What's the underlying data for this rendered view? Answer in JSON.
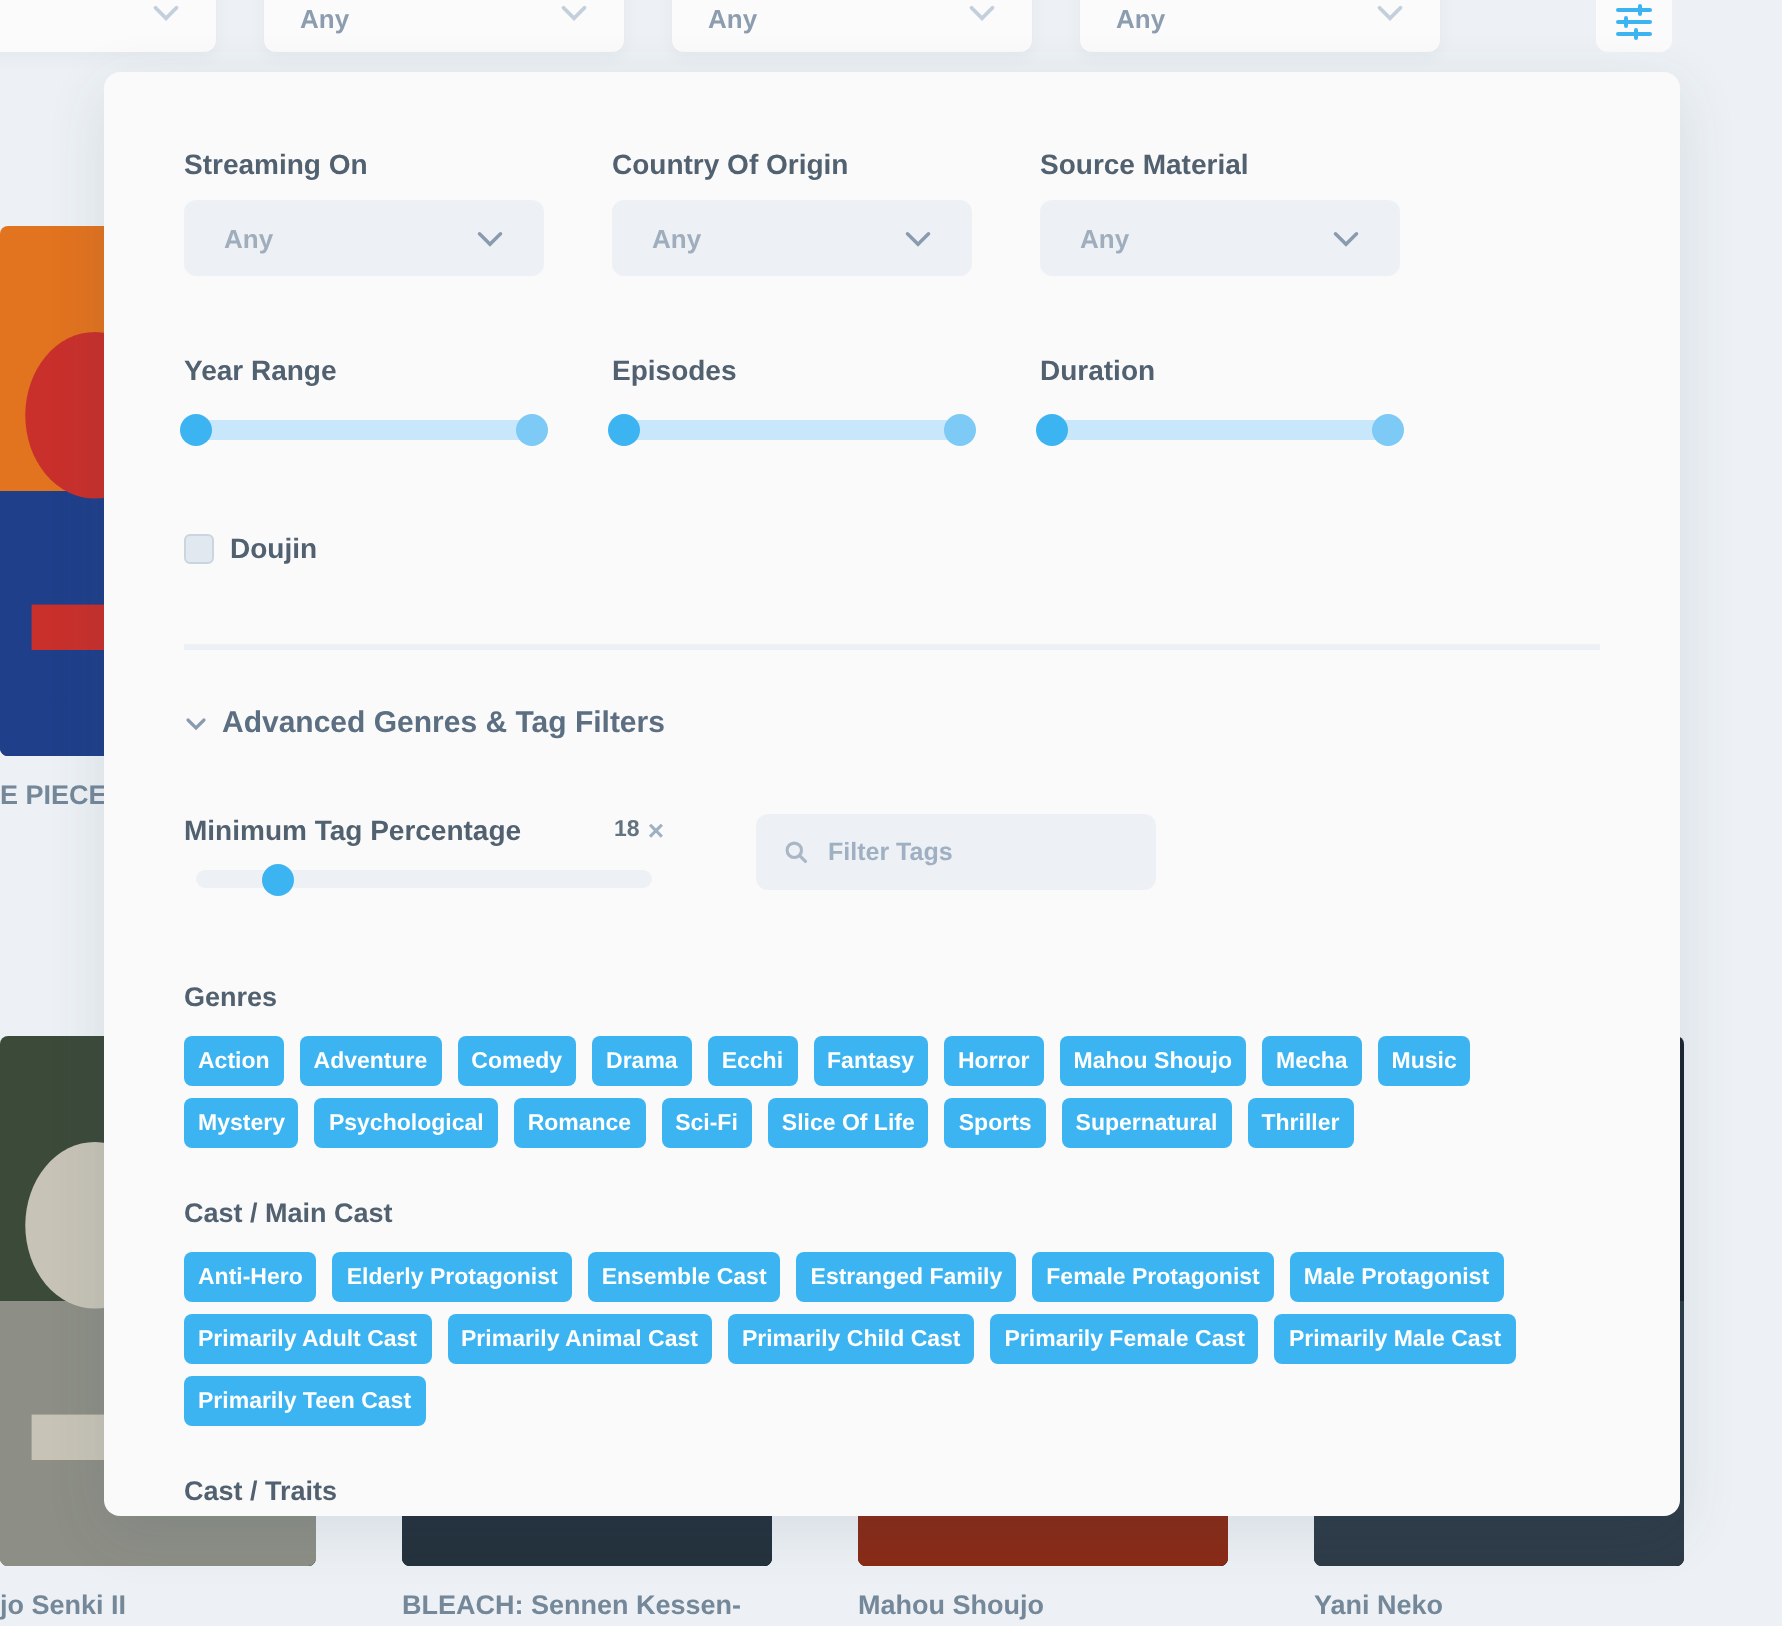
{
  "top_filters": [
    {
      "kind": "select"
    },
    {
      "kind": "select",
      "value": "Any"
    },
    {
      "kind": "select",
      "value": "Any"
    },
    {
      "kind": "select",
      "value": "Any"
    }
  ],
  "media_rows": [
    [
      {
        "title": "E PIECE"
      }
    ],
    [
      {
        "title": "jo Senki II"
      },
      {
        "title": "BLEACH: Sennen Kessen-"
      },
      {
        "title": "Mahou Shoujo"
      },
      {
        "title": "Yani Neko"
      }
    ]
  ],
  "filters": {
    "selects": [
      {
        "label": "Streaming On",
        "value": "Any"
      },
      {
        "label": "Country Of Origin",
        "value": "Any"
      },
      {
        "label": "Source Material",
        "value": "Any"
      }
    ],
    "ranges": [
      {
        "label": "Year Range",
        "thumbs": [
          {
            "level": 0
          },
          {
            "level": 1
          }
        ]
      },
      {
        "label": "Episodes",
        "thumbs": [
          {
            "level": 0
          },
          {
            "level": 1
          }
        ]
      },
      {
        "label": "Duration",
        "thumbs": [
          {
            "level": 0
          },
          {
            "level": 1
          }
        ]
      }
    ],
    "doujin": {
      "label": "Doujin",
      "checked": false
    }
  },
  "advanced": {
    "label": "Advanced Genres & Tag Filters",
    "expanded": true,
    "min_tag": {
      "label": "Minimum Tag Percentage",
      "reading": "18",
      "clear": "×",
      "level": 0.18
    },
    "search": {
      "placeholder": "Filter Tags"
    },
    "groups": [
      {
        "title": "Genres",
        "tags": [
          "Action",
          "Adventure",
          "Comedy",
          "Drama",
          "Ecchi",
          "Fantasy",
          "Horror",
          "Mahou Shoujo",
          "Mecha",
          "Music",
          "Mystery",
          "Psychological",
          "Romance",
          "Sci-Fi",
          "Slice Of Life",
          "Sports",
          "Supernatural",
          "Thriller"
        ]
      },
      {
        "title": "Cast / Main Cast",
        "tags": [
          "Anti-Hero",
          "Elderly Protagonist",
          "Ensemble Cast",
          "Estranged Family",
          "Female Protagonist",
          "Male Protagonist",
          "Primarily Adult Cast",
          "Primarily Animal Cast",
          "Primarily Child Cast",
          "Primarily Female Cast",
          "Primarily Male Cast",
          "Primarily Teen Cast"
        ]
      },
      {
        "title": "Cast / Traits"
      }
    ]
  }
}
